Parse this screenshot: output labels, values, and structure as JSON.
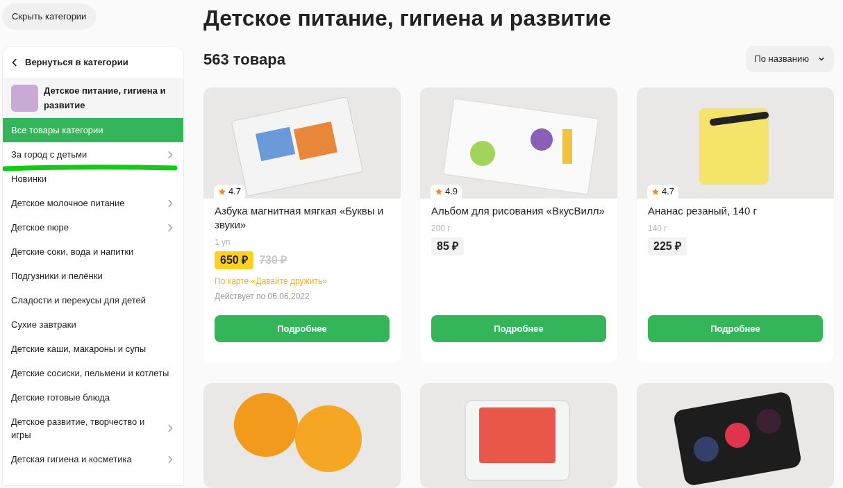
{
  "hide_button": "Скрыть категории",
  "sidebar": {
    "back": "Вернуться в категории",
    "category": "Детское питание, гигиена и развитие",
    "items": [
      {
        "label": "Все товары категории",
        "selected": true,
        "has_children": false
      },
      {
        "label": "За город с детьми",
        "selected": false,
        "has_children": true,
        "underlined": true
      },
      {
        "label": "Новинки",
        "selected": false,
        "has_children": false
      },
      {
        "label": "Детское молочное питание",
        "selected": false,
        "has_children": true
      },
      {
        "label": "Детское пюре",
        "selected": false,
        "has_children": true
      },
      {
        "label": "Детские соки, вода и напитки",
        "selected": false,
        "has_children": false
      },
      {
        "label": "Подгузники и пелёнки",
        "selected": false,
        "has_children": false
      },
      {
        "label": "Сладости и перекусы для детей",
        "selected": false,
        "has_children": false
      },
      {
        "label": "Сухие завтраки",
        "selected": false,
        "has_children": false
      },
      {
        "label": "Детские каши, макароны и супы",
        "selected": false,
        "has_children": false
      },
      {
        "label": "Детские сосиски, пельмени и котлеты",
        "selected": false,
        "has_children": false
      },
      {
        "label": "Детские готовые блюда",
        "selected": false,
        "has_children": false
      },
      {
        "label": "Детское развитие, творчество и игры",
        "selected": false,
        "has_children": true
      },
      {
        "label": "Детская гигиена и косметика",
        "selected": false,
        "has_children": true
      }
    ]
  },
  "title": "Детское питание, гигиена и развитие",
  "count": "563 товара",
  "sort": "По названию",
  "products": [
    {
      "kind": "full",
      "rating": "4.7",
      "name": "Азбука магнитная мягкая «Буквы и звуки»",
      "amount": "1 уп",
      "price": "650 ₽",
      "old_price": "730 ₽",
      "promo": "По карте «Давайте дружить»",
      "valid": "Действует по 06.06.2022",
      "button": "Подробнее"
    },
    {
      "kind": "full",
      "rating": "4.9",
      "name": "Альбом для рисования «ВкусВилл»",
      "amount": "200 г",
      "price": "85 ₽",
      "button": "Подробнее"
    },
    {
      "kind": "full",
      "rating": "4.7",
      "name": "Ананас резаный, 140 г",
      "amount": "140 г",
      "price": "225 ₽",
      "button": "Подробнее"
    },
    {
      "kind": "photo"
    },
    {
      "kind": "photo"
    },
    {
      "kind": "photo"
    }
  ]
}
